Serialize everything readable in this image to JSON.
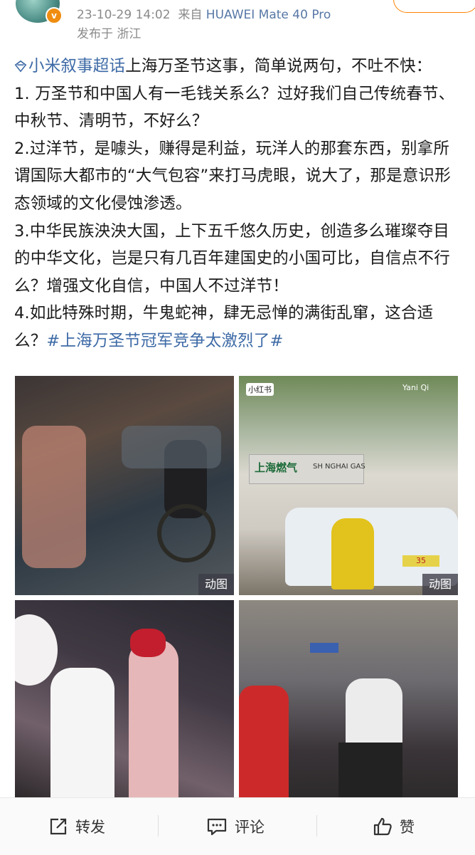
{
  "meta": {
    "date": "23-10-29 14:02",
    "source_prefix": "来自",
    "device": "HUAWEI Mate 40 Pro",
    "location": "发布于 浙江"
  },
  "post": {
    "topic": "小米叙事超话",
    "line_intro": "上海万圣节这事，简单说两句，不吐不快：",
    "p1": "1. 万圣节和中国人有一毛钱关系么？过好我们自己传统春节、中秋节、清明节，不好么？",
    "p2": "2.过洋节，是噱头，赚得是利益，玩洋人的那套东西，别拿所谓国际大都市的“大气包容”来打马虎眼，说大了，那是意识形态领域的文化侵蚀渗透。",
    "p3": "3.中华民族泱泱大国，上下五千悠久历史，创造多么璀璨夺目的中华文化，岂是只有几百年建国史的小国可比，自信点不行么？增强文化自信，中国人不过洋节！",
    "p4": "4.如此特殊时期，牛鬼蛇神，肆无忌惮的满街乱窜，这合适么？",
    "hashtag": "#上海万圣节冠军竞争太激烈了#"
  },
  "images": {
    "gif_label": "动图",
    "img2_watermark_app": "小红书",
    "img2_watermark_user": "Yani Qi",
    "img2_sign_cn": "上海燃气",
    "img2_sign_en": "SH NGHAI GAS",
    "img2_van_sign": "35"
  },
  "actions": {
    "repost": "转发",
    "comment": "评论",
    "like": "赞"
  },
  "colors": {
    "link": "#3d6aa6",
    "accent": "#ff8200",
    "meta": "#8a8a8a"
  }
}
